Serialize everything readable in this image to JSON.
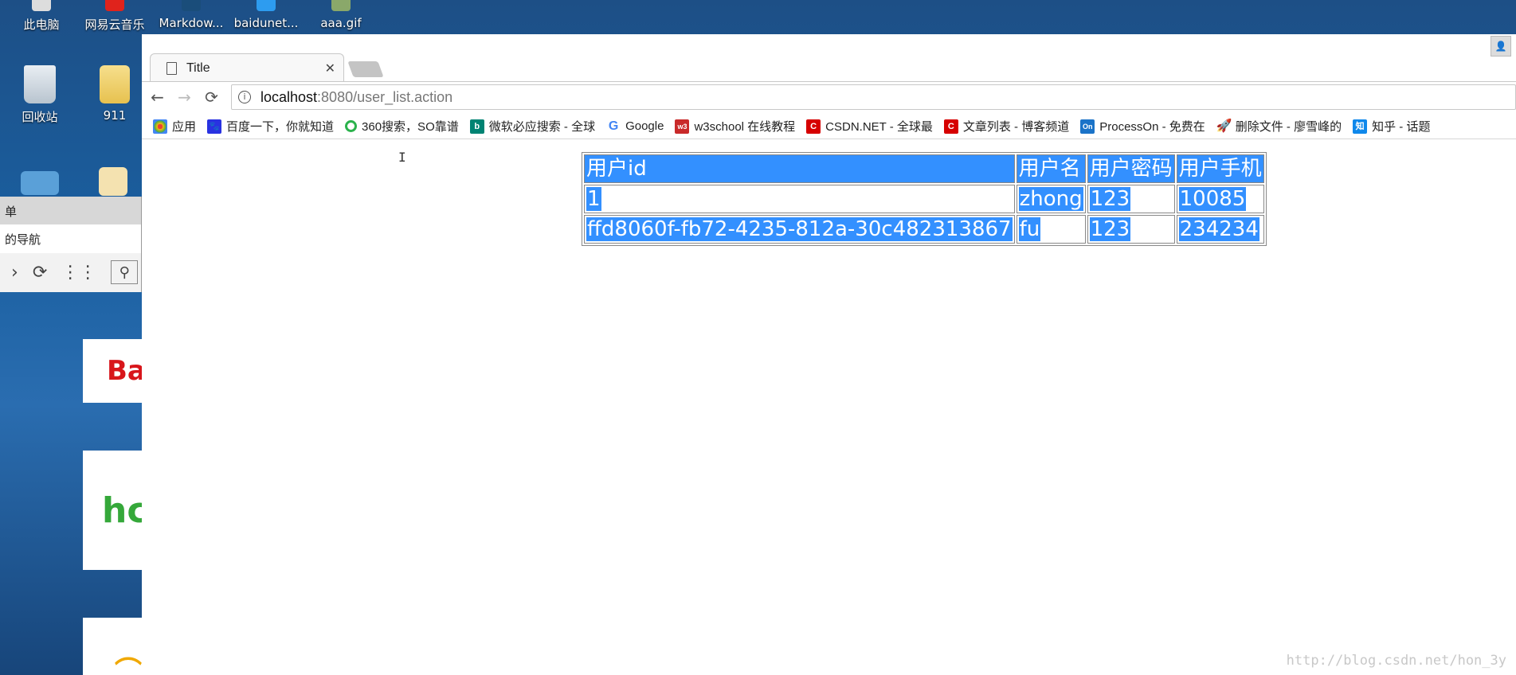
{
  "desktop": {
    "top_icons": [
      "此电脑",
      "网易云音乐",
      "Markdow...",
      "baidunet...",
      "aaa.gif"
    ],
    "icons": [
      {
        "label": "回收站",
        "icon": "recycle-bin-icon"
      },
      {
        "label": "911",
        "icon": "folder-icon"
      }
    ]
  },
  "edge_window": {
    "title_fragment": "单",
    "tab_fragment": "的导航",
    "tiles": [
      "Bai",
      "hc"
    ]
  },
  "browser": {
    "tab_title": "Title",
    "url_host": "localhost",
    "url_rest": ":8080/user_list.action",
    "bookmarks": [
      {
        "label": "应用",
        "icon": "apps-grid-icon",
        "color": "#4285f4"
      },
      {
        "label": "百度一下，你就知道",
        "icon": "baidu-paw-icon",
        "color": "#2932e1"
      },
      {
        "label": "360搜索，SO靠谱",
        "icon": "360-search-icon",
        "color": "#2bb24c"
      },
      {
        "label": "微软必应搜索 - 全球",
        "icon": "bing-icon",
        "color": "#008373"
      },
      {
        "label": "Google",
        "icon": "google-icon",
        "color": "#4285f4"
      },
      {
        "label": "w3school 在线教程",
        "icon": "w3school-icon",
        "color": "#c92a2a"
      },
      {
        "label": "CSDN.NET - 全球最",
        "icon": "csdn-icon",
        "color": "#d60000"
      },
      {
        "label": "文章列表 - 博客频道",
        "icon": "csdn-blog-icon",
        "color": "#d60000"
      },
      {
        "label": "ProcessOn - 免费在",
        "icon": "processon-icon",
        "color": "#1a73c8"
      },
      {
        "label": "删除文件 - 廖雪峰的",
        "icon": "rocket-icon",
        "color": "#2a6cd4"
      },
      {
        "label": "知乎 - 话题",
        "icon": "zhihu-icon",
        "color": "#0f88eb"
      }
    ]
  },
  "table": {
    "headers": [
      "用户id",
      "用户名",
      "用户密码",
      "用户手机"
    ],
    "rows": [
      [
        "1",
        "zhong",
        "123",
        "10085"
      ],
      [
        "ffd8060f-fb72-4235-812a-30c482313867",
        "fu",
        "123",
        "234234"
      ]
    ]
  },
  "watermark": "http://blog.csdn.net/hon_3y",
  "colors": {
    "selection": "#3390ff"
  }
}
